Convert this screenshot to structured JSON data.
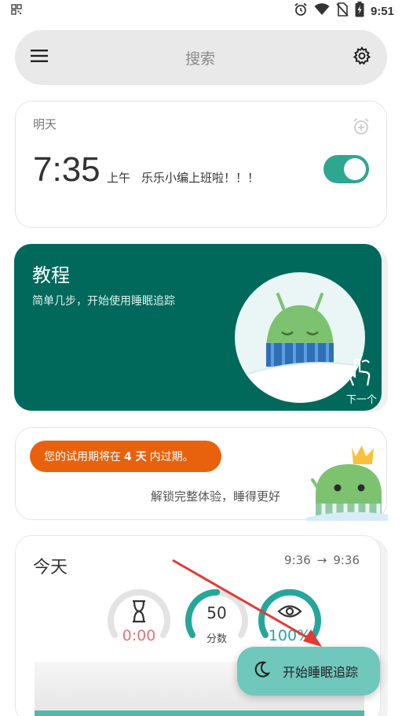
{
  "status_bar": {
    "time": "9:51",
    "icons": [
      "qr-icon",
      "alarm-icon",
      "wifi-icon",
      "no-sim-icon",
      "battery-charging-icon"
    ]
  },
  "search": {
    "placeholder": "搜索",
    "left_icon": "menu-icon",
    "right_icon": "gear-icon"
  },
  "alarm": {
    "day": "明天",
    "time": "7:35",
    "ampm": "上午",
    "label": "乐乐小编上班啦！！！",
    "enabled": true,
    "accent": "#2ea690"
  },
  "tutorial": {
    "title": "教程",
    "subtitle": "简单几步，开始使用睡眠追踪",
    "next_label": "下一个",
    "background": "#00695c"
  },
  "trial": {
    "badge_prefix": "您的试用期将在",
    "badge_days": "4 天",
    "badge_suffix": "内过期。",
    "subtitle": "解锁完整体验，睡得更好",
    "badge_color": "#e8610c"
  },
  "today": {
    "title": "今天",
    "range_start": "9:36",
    "range_arrow": "→",
    "range_end": "9:36",
    "gauges": {
      "duration": {
        "value": "0:00",
        "color": "#e57373",
        "fraction": 0.0
      },
      "score": {
        "value": "50",
        "label": "分数",
        "color": "#26a69a",
        "fraction": 0.5
      },
      "efficiency": {
        "value": "100%",
        "color": "#26a69a",
        "fraction": 1.0
      }
    }
  },
  "fab": {
    "label": "开始睡眠追踪",
    "icon": "moon-icon",
    "color": "#70c7bc"
  }
}
